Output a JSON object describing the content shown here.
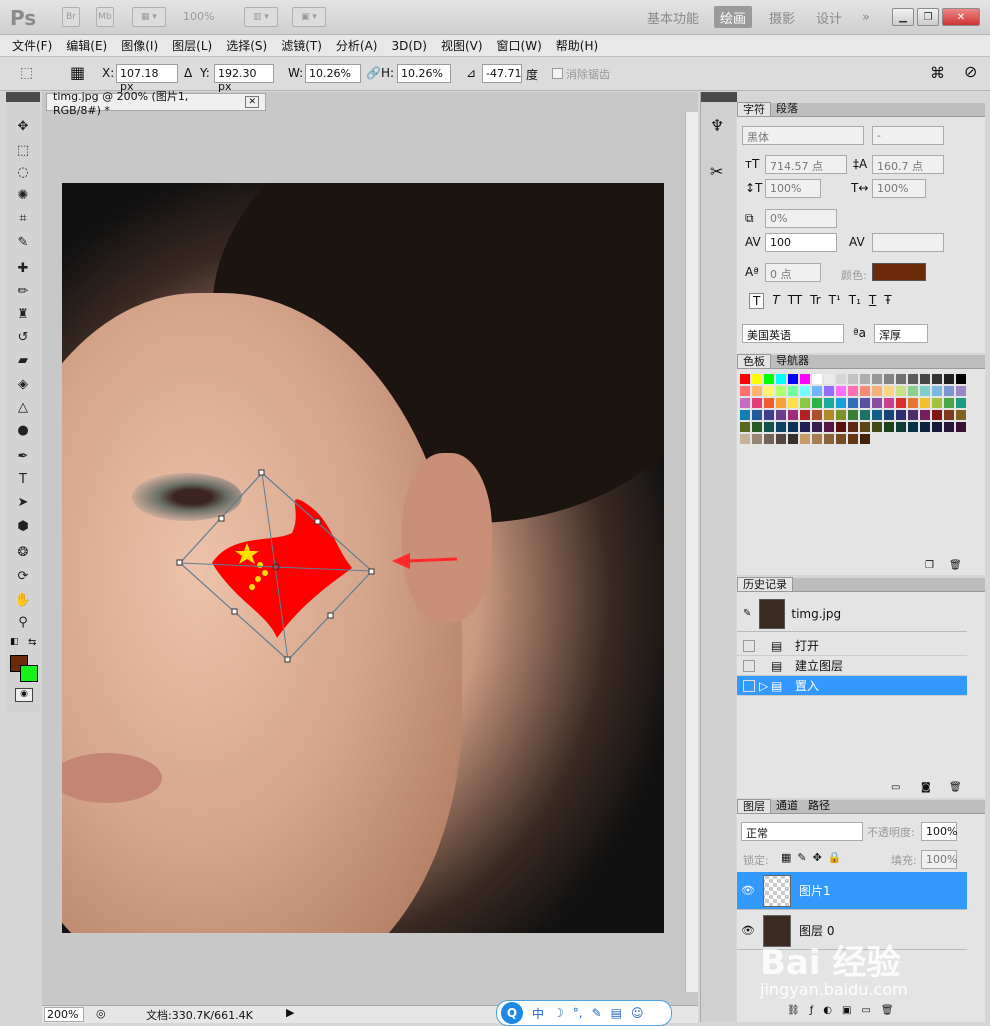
{
  "titlebar": {
    "logo": "Ps",
    "btn_br": "Br",
    "btn_mb": "Mb",
    "zoom": "100%",
    "workspaces": [
      "基本功能",
      "绘画",
      "摄影",
      "设计"
    ],
    "active_workspace": "绘画",
    "more": "»"
  },
  "menu": [
    "文件(F)",
    "编辑(E)",
    "图像(I)",
    "图层(L)",
    "选择(S)",
    "滤镜(T)",
    "分析(A)",
    "3D(D)",
    "视图(V)",
    "窗口(W)",
    "帮助(H)"
  ],
  "options": {
    "x_label": "X:",
    "x_value": "107.18 px",
    "y_label": "Y:",
    "y_value": "192.30 px",
    "w_label": "W:",
    "w_value": "10.26%",
    "h_label": "H:",
    "h_value": "10.26%",
    "angle_value": "-47.71",
    "angle_unit": "度",
    "antialias": "消除锯齿"
  },
  "document": {
    "tab_title": "timg.jpg @ 200% (图片1, RGB/8#) *",
    "zoom": "200%",
    "doc_size": "文档:330.7K/661.4K"
  },
  "character": {
    "tabs": [
      "字符",
      "段落"
    ],
    "font_family": "黑体",
    "font_style": "-",
    "font_size": "714.57 点",
    "leading": "160.7 点",
    "vscale": "100%",
    "hscale": "100%",
    "tracking_pct": "0%",
    "kerning": "100",
    "baseline": "0 点",
    "color_label": "颜色:",
    "color": "#6b2a0a",
    "styles": [
      "T",
      "T",
      "TT",
      "Tr",
      "T¹",
      "T₁",
      "T",
      "Ŧ"
    ],
    "language": "美国英语",
    "aa_icon": "ªa",
    "aa_mode": "浑厚"
  },
  "swatches": {
    "tabs": [
      "色板",
      "导航器"
    ],
    "colors": [
      "#ff0000",
      "#ffff00",
      "#00ff00",
      "#00ffff",
      "#0000ff",
      "#ff00ff",
      "#ffffff",
      "#ebebeb",
      "#d6d6d6",
      "#c2c2c2",
      "#adadad",
      "#999999",
      "#858585",
      "#707070",
      "#5c5c5c",
      "#474747",
      "#333333",
      "#1f1f1f",
      "#000000",
      "#ff6f6f",
      "#ffb36f",
      "#fff36f",
      "#b0ff6f",
      "#6fffa0",
      "#6fffff",
      "#6fb4ff",
      "#8f6fff",
      "#ff6fff",
      "#ff6fb4",
      "#f48c75",
      "#f6b07a",
      "#f9d682",
      "#c7e18a",
      "#8ccf8f",
      "#80cfc6",
      "#7ab8e0",
      "#7c96d0",
      "#9b87c8",
      "#c36fbf",
      "#e3407a",
      "#f25c2e",
      "#f8a33a",
      "#fde04a",
      "#8dc641",
      "#2db34a",
      "#1daa9b",
      "#1aa0d8",
      "#2f6fba",
      "#5a4fa3",
      "#8c4ea1",
      "#c9408e",
      "#d92f2f",
      "#e5762f",
      "#f0c02f",
      "#a3c33a",
      "#49a843",
      "#1c9a84",
      "#147fb5",
      "#1e5a9c",
      "#3f3f91",
      "#6a3d8e",
      "#9b2d7c",
      "#b22222",
      "#a9512b",
      "#b28a2a",
      "#7d922c",
      "#3a7e33",
      "#1b7262",
      "#125f87",
      "#174479",
      "#2d2d6f",
      "#4e2d6b",
      "#731f5d",
      "#7f1717",
      "#7d3a1e",
      "#7f621f",
      "#5a6920",
      "#2a5b25",
      "#135248",
      "#0d4462",
      "#103157",
      "#202050",
      "#381f4d",
      "#531643",
      "#5b1010",
      "#5a2a15",
      "#5b4616",
      "#404b17",
      "#1e411a",
      "#0e3b34",
      "#093147",
      "#0b233f",
      "#171739",
      "#281637",
      "#3c1030",
      "#c7b299",
      "#998675",
      "#736357",
      "#534741",
      "#37302a",
      "#c69c6d",
      "#a67c52",
      "#8c6239",
      "#754c24",
      "#603913",
      "#42210b"
    ]
  },
  "history": {
    "tab": "历史记录",
    "snapshot": "timg.jpg",
    "items": [
      "打开",
      "建立图层",
      "置入"
    ]
  },
  "layers": {
    "tabs": [
      "图层",
      "通道",
      "路径"
    ],
    "blend_mode": "正常",
    "opacity_label": "不透明度:",
    "opacity": "100%",
    "lock_label": "锁定:",
    "fill_label": "填充:",
    "fill": "100%",
    "rows": [
      "图片1",
      "图层 0"
    ]
  },
  "watermark": {
    "brand": "Bai 经验",
    "url": "jingyan.baidu.com"
  },
  "ime_bar": [
    "中",
    "☽",
    "°,",
    "✎",
    "▤",
    "☺"
  ]
}
